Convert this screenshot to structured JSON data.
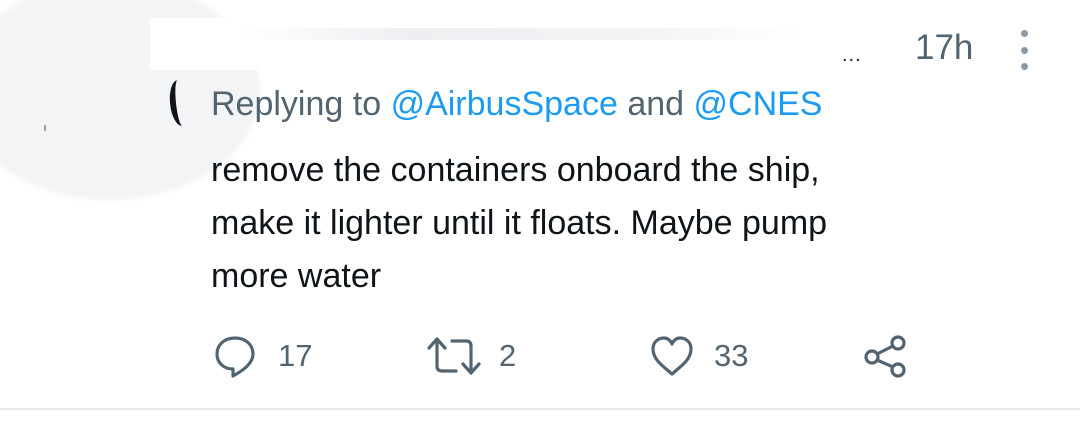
{
  "tweet": {
    "truncated_header": "...",
    "time": "17h",
    "replying_prefix": "Replying to",
    "mention_1": "@AirbusSpace",
    "connector": "and",
    "mention_2": "@CNES",
    "body_lines": [
      "remove the containers onboard the ship,",
      "make it lighter until it floats. Maybe pump",
      "more water"
    ]
  },
  "actions": {
    "reply": {
      "icon": "reply-icon",
      "count": "17"
    },
    "retweet": {
      "icon": "retweet-icon",
      "count": "2"
    },
    "like": {
      "icon": "heart-icon",
      "count": "33"
    },
    "share": {
      "icon": "share-icon"
    }
  },
  "colors": {
    "text": "#0f1419",
    "secondary": "#536471",
    "link": "#1d9bf0",
    "divider": "#e6e9ec"
  }
}
